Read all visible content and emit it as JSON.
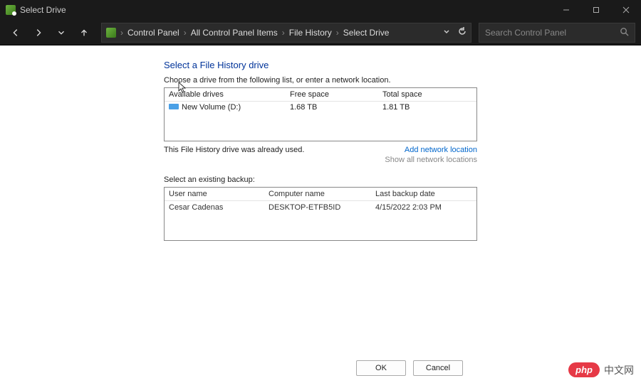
{
  "window": {
    "title": "Select Drive"
  },
  "breadcrumbs": {
    "items": [
      "Control Panel",
      "All Control Panel Items",
      "File History",
      "Select Drive"
    ]
  },
  "search": {
    "placeholder": "Search Control Panel"
  },
  "page": {
    "title": "Select a File History drive",
    "instruction": "Choose a drive from the following list, or enter a network location."
  },
  "drives": {
    "headers": {
      "a": "Available drives",
      "b": "Free space",
      "c": "Total space"
    },
    "row": {
      "name": "New Volume (D:)",
      "free": "1.68 TB",
      "total": "1.81 TB"
    }
  },
  "status": {
    "used_msg": "This File History drive was already used.",
    "add_link": "Add network location",
    "show_all": "Show all network locations"
  },
  "backup": {
    "label": "Select an existing backup:",
    "headers": {
      "a": "User name",
      "b": "Computer name",
      "c": "Last backup date"
    },
    "row": {
      "user": "Cesar Cadenas",
      "computer": "DESKTOP-ETFB5ID",
      "date": "4/15/2022 2:03 PM"
    }
  },
  "buttons": {
    "ok": "OK",
    "cancel": "Cancel"
  },
  "watermark": {
    "logo": "php",
    "text": "中文网"
  }
}
